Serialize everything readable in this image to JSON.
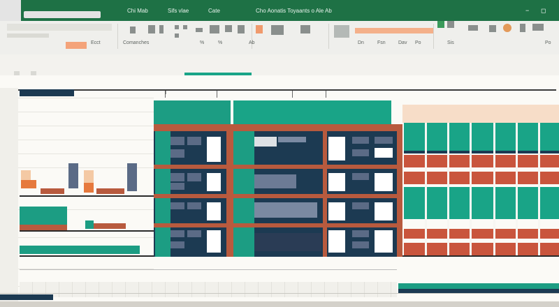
{
  "window": {
    "tabs": [
      "Chi Mab",
      "Sifs vlae",
      "Cate",
      "Cho Aonatis Toyaants o Ale Ab"
    ],
    "controls": {
      "minimize": "−",
      "restore": "◻"
    }
  },
  "ribbon": {
    "labels": [
      "Ecct",
      "Comanches",
      "%",
      "%",
      "Ab",
      "Dn",
      "Fsn",
      "Dav",
      "Po",
      "Sis",
      "Po"
    ]
  },
  "colors": {
    "title_bar": "#1e7145",
    "teal": "#19a487",
    "dark_navy": "#1c3a52",
    "rust": "#b85a3e",
    "orange": "#e6793d",
    "peach": "#f4c9a4"
  },
  "icons": [
    "cursor-icon"
  ]
}
